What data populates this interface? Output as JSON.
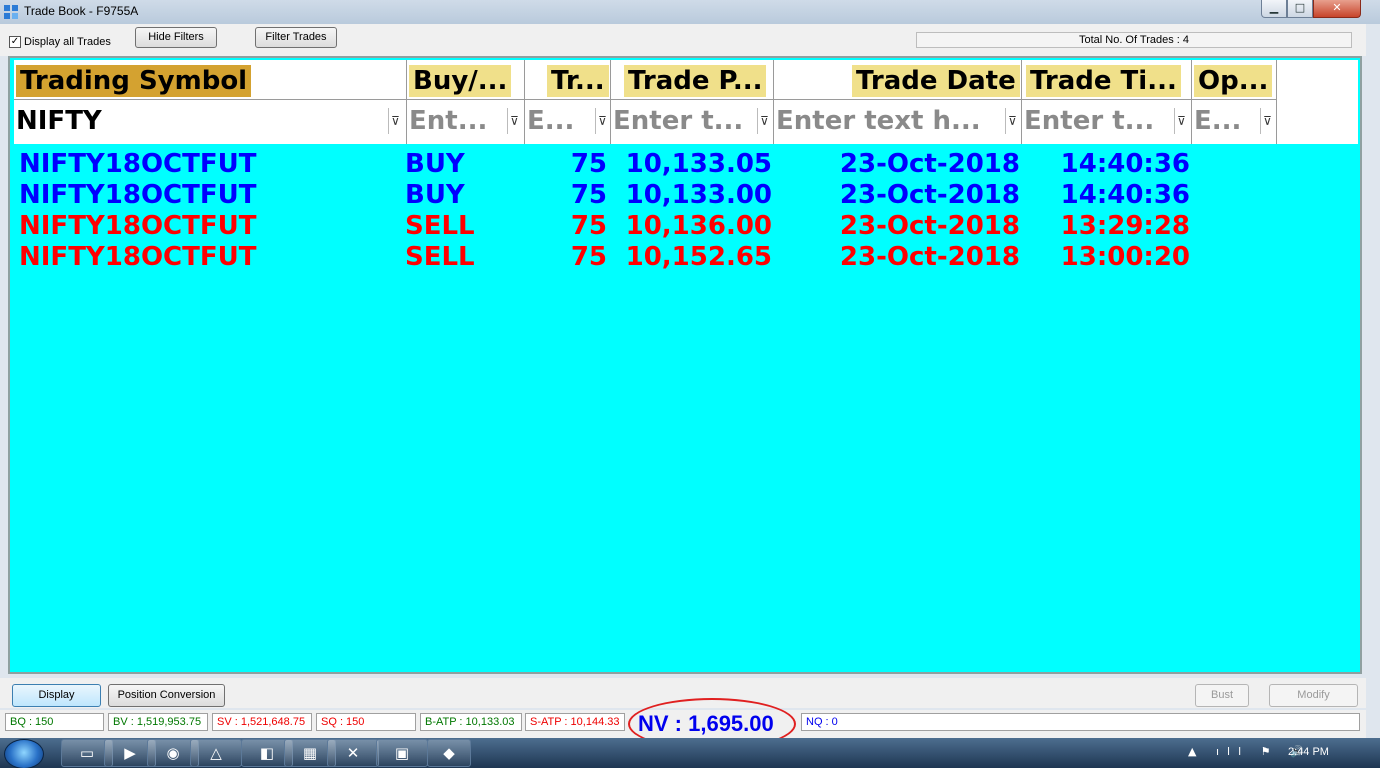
{
  "window": {
    "title": "Trade Book - F9755A",
    "min": "▁",
    "max": "□",
    "close": "✕"
  },
  "toolbar": {
    "display_all_checked": "✓",
    "display_all_label": "Display all Trades",
    "hide_filters": "Hide Filters",
    "filter_trades": "Filter Trades",
    "total_trades": "Total No. Of Trades : 4"
  },
  "grid": {
    "columns": [
      {
        "label": "Trading Symbol",
        "filter": "NIFTY"
      },
      {
        "label": "Buy/...",
        "filter": "Ent..."
      },
      {
        "label": "Tr...",
        "filter": "E..."
      },
      {
        "label": "Trade P...",
        "filter": "Enter t..."
      },
      {
        "label": "Trade Date",
        "filter": "Enter text h..."
      },
      {
        "label": "Trade Ti...",
        "filter": "Enter t..."
      },
      {
        "label": "Op...",
        "filter": "E..."
      }
    ],
    "filter_icon": "⊽",
    "rows": [
      {
        "symbol": "NIFTY18OCTFUT",
        "side": "BUY",
        "qty": "75",
        "price": "10,133.05",
        "date": "23-Oct-2018",
        "time": "14:40:36"
      },
      {
        "symbol": "NIFTY18OCTFUT",
        "side": "BUY",
        "qty": "75",
        "price": "10,133.00",
        "date": "23-Oct-2018",
        "time": "14:40:36"
      },
      {
        "symbol": "NIFTY18OCTFUT",
        "side": "SELL",
        "qty": "75",
        "price": "10,136.00",
        "date": "23-Oct-2018",
        "time": "13:29:28"
      },
      {
        "symbol": "NIFTY18OCTFUT",
        "side": "SELL",
        "qty": "75",
        "price": "10,152.65",
        "date": "23-Oct-2018",
        "time": "13:00:20"
      }
    ]
  },
  "buttons": {
    "display": "Display",
    "position_conversion": "Position Conversion",
    "bust": "Bust",
    "modify": "Modify"
  },
  "status": {
    "bq": "BQ : 150",
    "bv": "BV : 1,519,953.75",
    "sv": "SV : 1,521,648.75",
    "sq": "SQ : 150",
    "batp": "B-ATP : 10,133.03",
    "satp": "S-ATP : 10,144.33",
    "nv": "NV : 1,695.00",
    "nq": "NQ : 0"
  },
  "taskbar": {
    "clock": "2:44 PM",
    "tray": "▲ ıll ⚑ 🔊"
  },
  "colors": {
    "grid_bg": "#00ffff",
    "buy": "#0000ff",
    "sell": "#ff0000",
    "symbol_header": "#d4a230",
    "header": "#f0e08a"
  }
}
